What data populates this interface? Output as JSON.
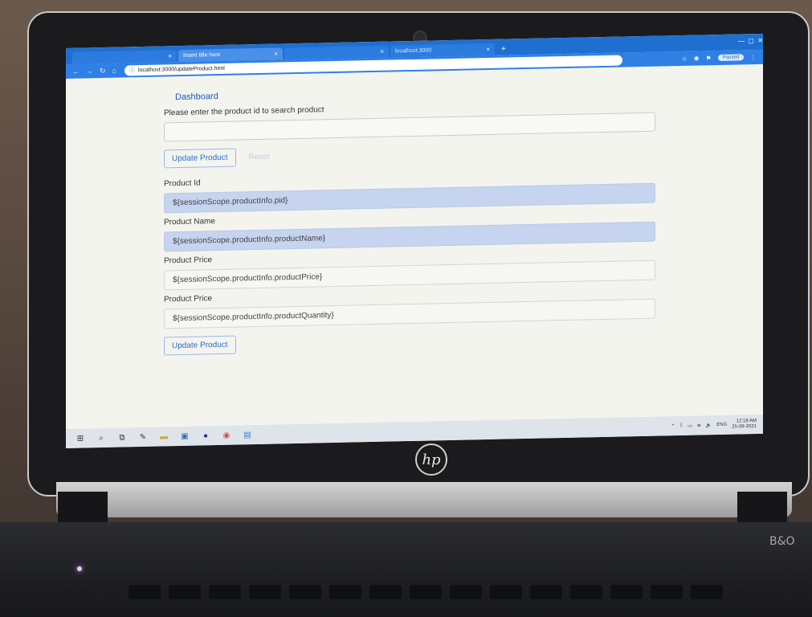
{
  "browser": {
    "tabs": [
      {
        "title": "",
        "active": false
      },
      {
        "title": "Insert title here",
        "active": true
      },
      {
        "title": "",
        "active": false
      },
      {
        "title": "localhost:3000",
        "active": false
      }
    ],
    "url": "localhost:3000/updateProduct.html",
    "profile_status": "Paused"
  },
  "page": {
    "dashboard_link": "Dashboard",
    "search_prompt": "Please enter the product id to search product",
    "search_value": "",
    "update_button": "Update Product",
    "reset_button": "Reset",
    "fields": [
      {
        "label": "Product Id",
        "value": "${sessionScope.productInfo.pid}",
        "autofilled": true
      },
      {
        "label": "Product Name",
        "value": "${sessionScope.productInfo.productName}",
        "autofilled": true
      },
      {
        "label": "Product Price",
        "value": "${sessionScope.productInfo.productPrice}",
        "autofilled": false
      },
      {
        "label": "Product Price",
        "value": "${sessionScope.productInfo.productQuantity}",
        "autofilled": false
      }
    ],
    "submit_button": "Update Product"
  },
  "taskbar": {
    "language": "ENG",
    "time": "12:18 AM",
    "date": "25-09-2021"
  },
  "laptop": {
    "brand": "hp",
    "model_badge": "B&O"
  }
}
